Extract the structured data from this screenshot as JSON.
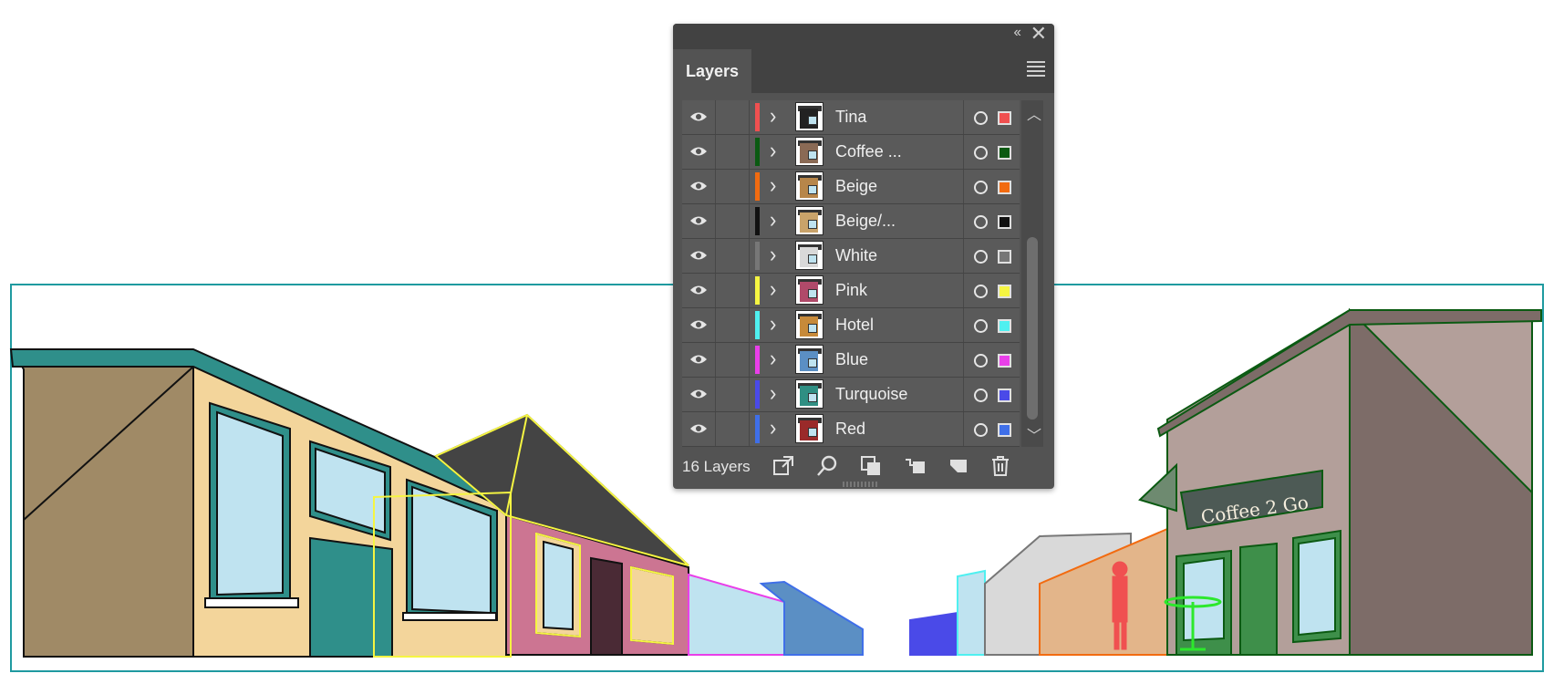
{
  "panel": {
    "collapse_label": "‹‹",
    "close_label": "✕",
    "tab_label": "Layers",
    "layer_count_label": "16 Layers"
  },
  "layers": [
    {
      "name": "Tina",
      "color": "#f05050",
      "thumb": "#222222"
    },
    {
      "name": "Coffee ...",
      "color": "#0b5a12",
      "thumb": "#8a6a55"
    },
    {
      "name": "Beige",
      "color": "#f26b10",
      "thumb": "#b7864a"
    },
    {
      "name": "Beige/...",
      "color": "#111111",
      "thumb": "#c9a36a"
    },
    {
      "name": "White",
      "color": "#777777",
      "thumb": "#d9d9d9"
    },
    {
      "name": "Pink",
      "color": "#f5f542",
      "thumb": "#b04a6a"
    },
    {
      "name": "Hotel",
      "color": "#4ff0f0",
      "thumb": "#c78a3a"
    },
    {
      "name": "Blue",
      "color": "#e93fe9",
      "thumb": "#5b8fc4"
    },
    {
      "name": "Turquoise",
      "color": "#4a4ae8",
      "thumb": "#2f8f83"
    },
    {
      "name": "Red",
      "color": "#3f6fe8",
      "thumb": "#9a2a2a"
    }
  ],
  "artwork": {
    "sign_text": "Coffee 2 Go"
  },
  "footer_icons": [
    "export-icon",
    "locate-object-icon",
    "make-clipping-mask-icon",
    "create-sublayer-icon",
    "create-new-layer-icon",
    "delete-layer-icon"
  ]
}
